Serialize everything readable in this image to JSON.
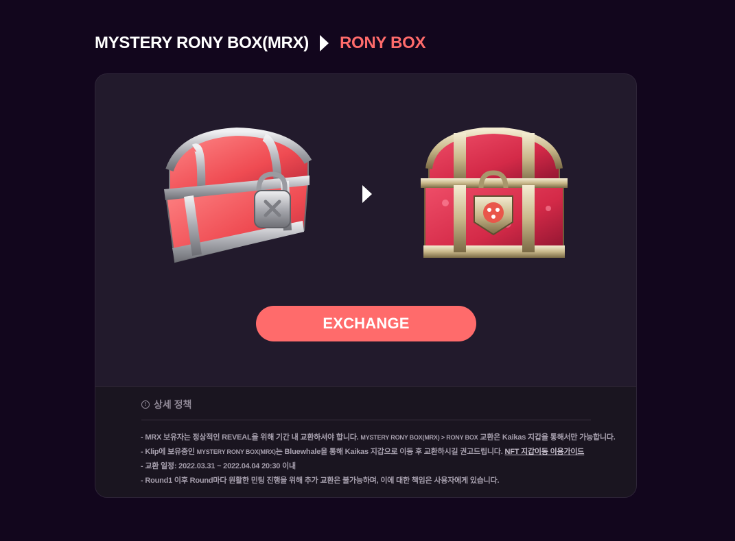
{
  "breadcrumb": {
    "from": "MYSTERY RONY BOX(MRX)",
    "to": "RONY BOX"
  },
  "exchange": {
    "button_label": "EXCHANGE"
  },
  "policy": {
    "title": "상세 정책",
    "items": [
      {
        "a": "- MRX 보유자는 정상적인 REVEAL을 위해 기간 내 교환하셔야 합니다. ",
        "b": "MYSTERY RONY BOX(MRX) > RONY BOX",
        "c": " 교환은 Kaikas 지갑을 통해서만 가능합니다."
      },
      {
        "a": "- Klip에 보유중인 ",
        "b": "MYSTERY RONY BOX(MRX)",
        "c": "는 Bluewhale을 통해 Kaikas 지갑으로 이동 후 교환하시길 권고드립니다. ",
        "link": "NFT 지갑이동 이용가이드"
      },
      {
        "a": "- 교환 일정: 2022.03.31 ~ 2022.04.04 20:30 이내"
      },
      {
        "a": "- Round1 이후 Round마다 원활한 민팅 진행을 위해 추가 교환은 불가능하며, 이에 대한 책임은 사용자에게 있습니다."
      }
    ]
  },
  "colors": {
    "background": "#12061d",
    "card": "#221a2c",
    "accent": "#ff6b6b"
  },
  "icons": {
    "chevron": "chevron-right-icon",
    "info": "info-circle-icon"
  }
}
